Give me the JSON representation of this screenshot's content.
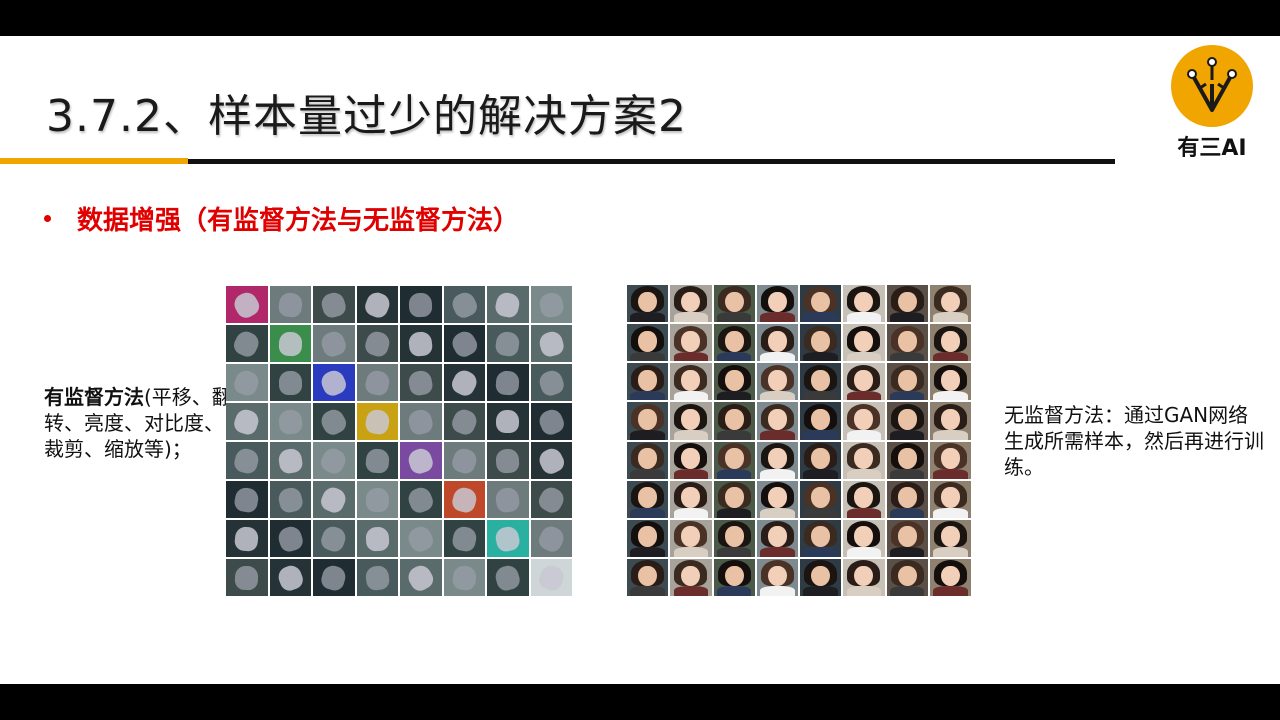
{
  "slide": {
    "title": "3.7.2、样本量过少的解决方案2",
    "logo_text": "有三AI",
    "bullet": "数据增强（有监督方法与无监督方法）",
    "left_text_bold": "有监督方法",
    "left_text_rest": "(平移、翻转、亮度、对比度、裁剪、缩放等)；",
    "right_text": "无监督方法：通过GAN网络生成所需样本，然后再进行训练。"
  },
  "colors": {
    "accent": "#f0a500",
    "bullet_red": "#e00000",
    "rule": "#111111"
  },
  "images": {
    "augmentation_grid": {
      "rows": 8,
      "cols": 8,
      "icon": "cat-augmentation-grid"
    },
    "gan_faces_grid": {
      "rows": 8,
      "cols": 8,
      "icon": "gan-faces-grid"
    }
  }
}
